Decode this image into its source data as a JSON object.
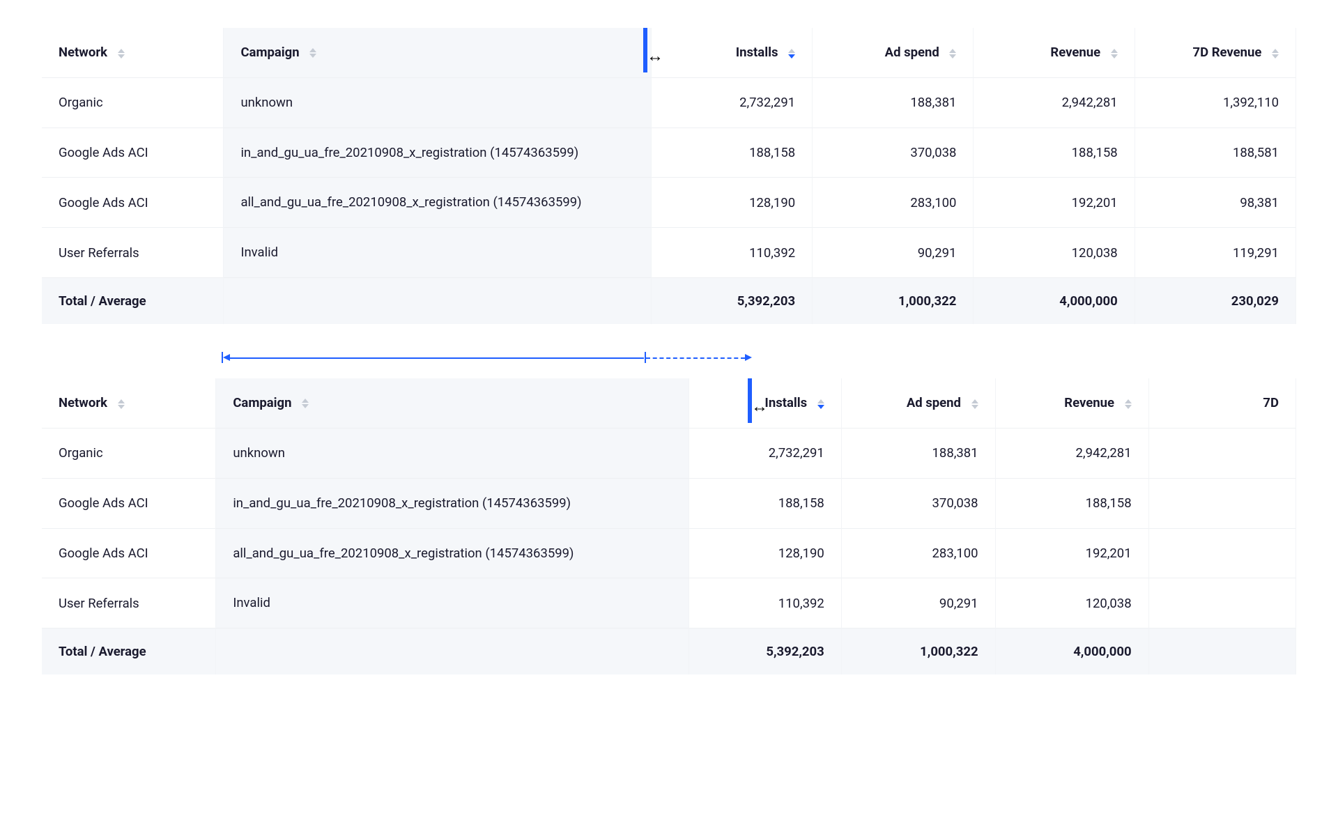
{
  "colors": {
    "accent": "#1f5eff",
    "header_bg": "#f5f7fa"
  },
  "columns": {
    "network": {
      "label": "Network"
    },
    "campaign": {
      "label": "Campaign"
    },
    "installs": {
      "label": "Installs",
      "sort": "desc"
    },
    "adspend": {
      "label": "Ad spend"
    },
    "revenue": {
      "label": "Revenue"
    },
    "rev7d": {
      "label": "7D Revenue"
    },
    "rev7d_short": {
      "label": "7D"
    }
  },
  "rows": [
    {
      "network": "Organic",
      "campaign": "unknown",
      "installs": "2,732,291",
      "adspend": "188,381",
      "revenue": "2,942,281",
      "rev7d": "1,392,110"
    },
    {
      "network": "Google Ads ACI",
      "campaign": "in_and_gu_ua_fre_20210908_x_registration (14574363599)",
      "installs": "188,158",
      "adspend": "370,038",
      "revenue": "188,158",
      "rev7d": "188,581"
    },
    {
      "network": "Google Ads ACI",
      "campaign": "all_and_gu_ua_fre_20210908_x_registration (14574363599)",
      "installs": "128,190",
      "adspend": "283,100",
      "revenue": "192,201",
      "rev7d": "98,381"
    },
    {
      "network": "User Referrals",
      "campaign": "Invalid",
      "installs": "110,392",
      "adspend": "90,291",
      "revenue": "120,038",
      "rev7d": "119,291"
    }
  ],
  "totals": {
    "label": "Total / Average",
    "installs": "5,392,203",
    "adspend": "1,000,322",
    "revenue": "4,000,000",
    "rev7d": "230,029"
  }
}
